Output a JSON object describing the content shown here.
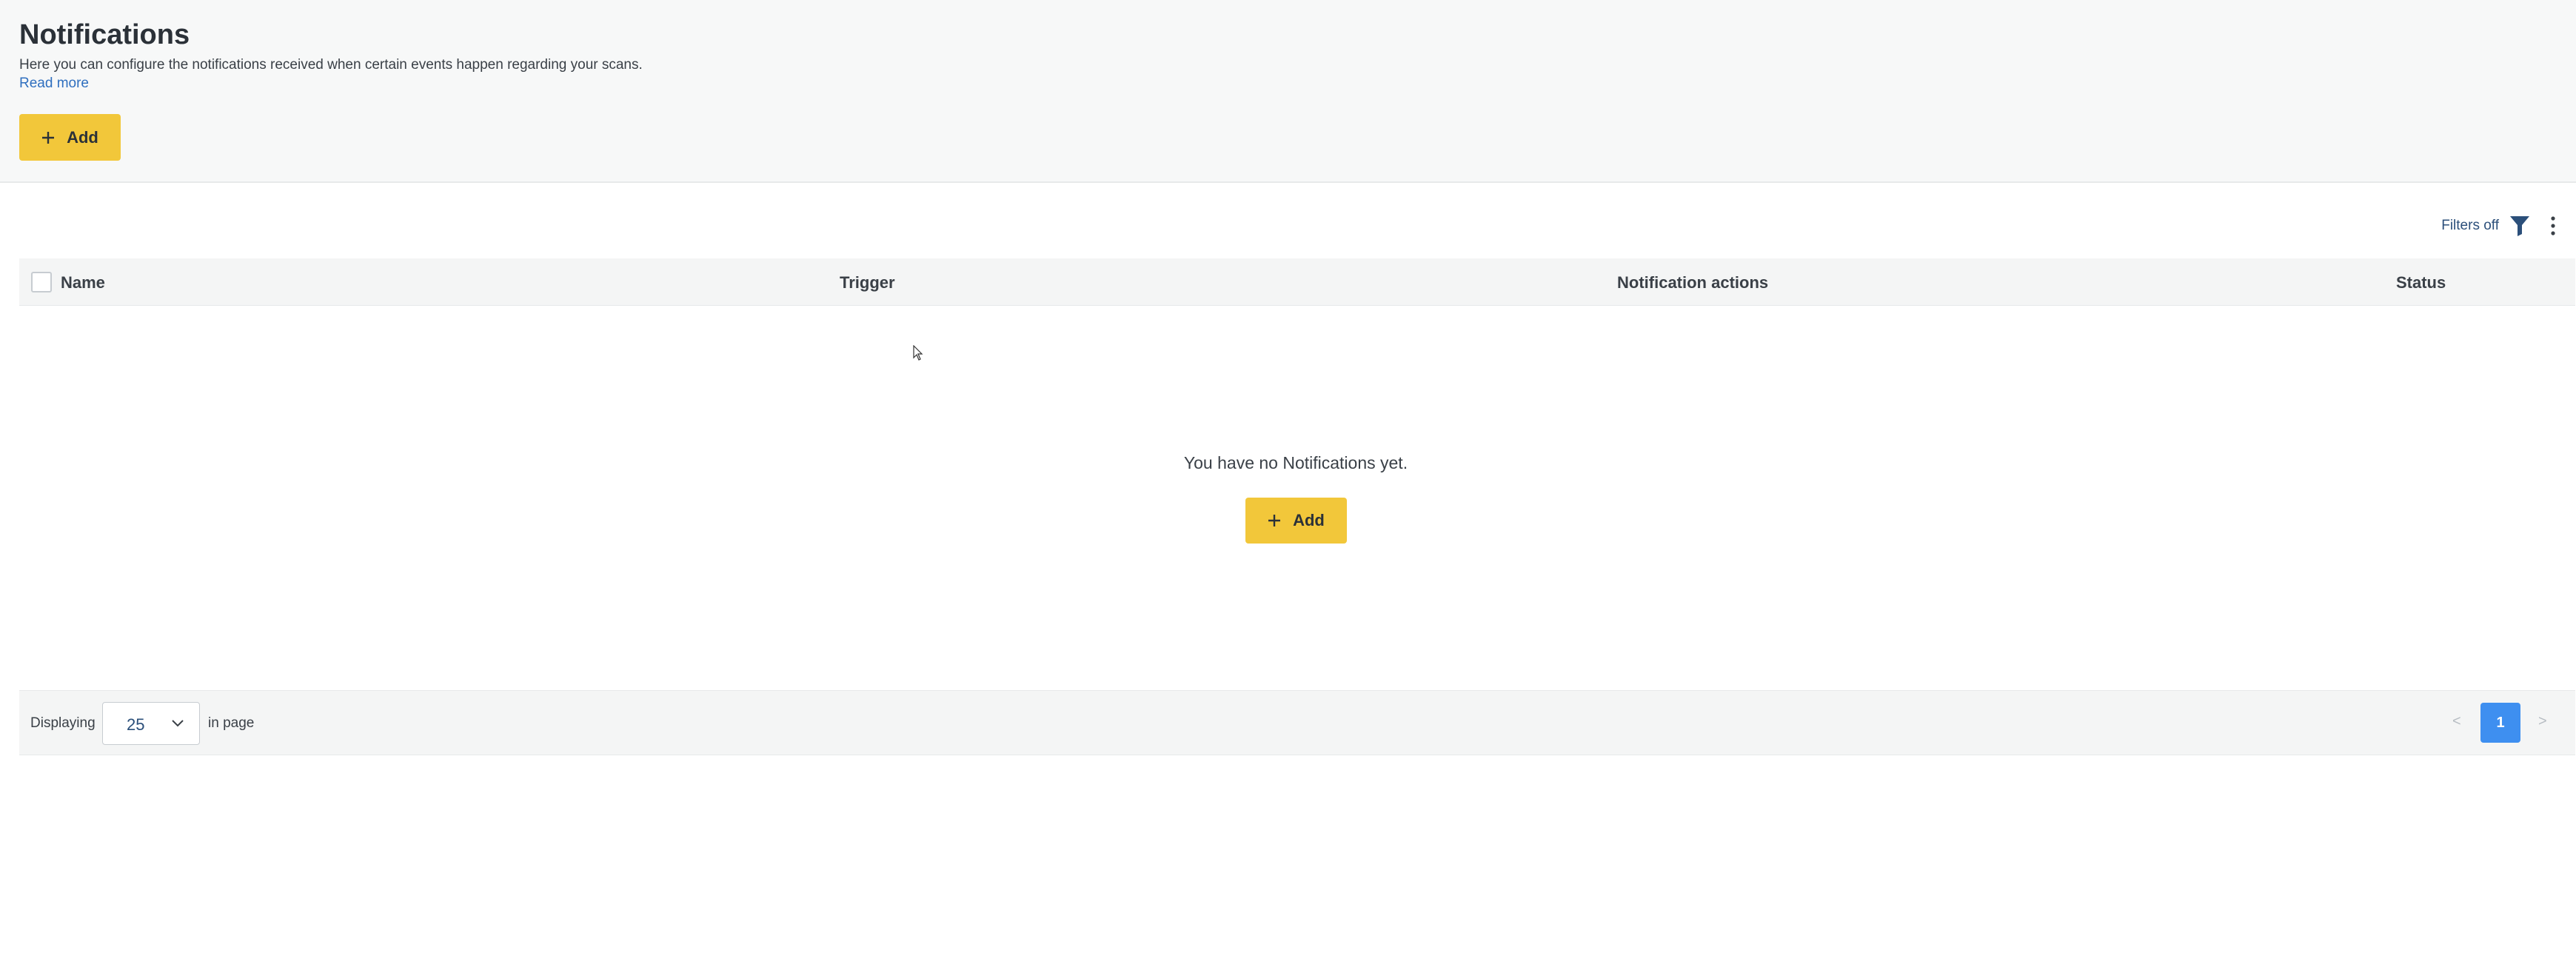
{
  "header": {
    "title": "Notifications",
    "description": "Here you can configure the notifications received when certain events happen regarding your scans.",
    "read_more": "Read more",
    "add_label": "Add"
  },
  "toolbar": {
    "filters_label": "Filters off",
    "filter_icon": "funnel-icon",
    "more_icon": "kebab-menu-icon"
  },
  "table": {
    "columns": [
      "Name",
      "Trigger",
      "Notification actions",
      "Status"
    ]
  },
  "empty_state": {
    "message": "You have no Notifications yet.",
    "add_label": "Add"
  },
  "pagination": {
    "displaying_label": "Displaying",
    "page_size": "25",
    "in_page_label": "in page",
    "prev": "<",
    "current_page": "1",
    "next": ">"
  },
  "colors": {
    "accent_button": "#f2c73a",
    "link": "#2f6fbf",
    "active_page": "#3e8ff0"
  }
}
